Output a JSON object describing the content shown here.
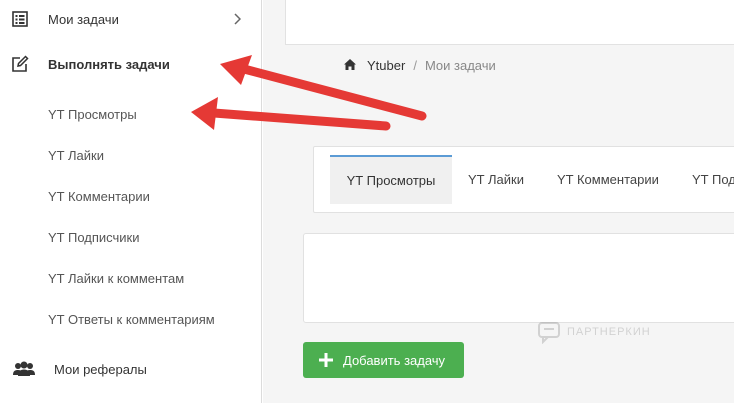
{
  "sidebar": {
    "my_tasks": "Мои задачи",
    "do_tasks": "Выполнять задачи",
    "sub_items": [
      "YT Просмотры",
      "YT Лайки",
      "YT Комментарии",
      "YT Подписчики",
      "YT Лайки к комментам",
      "YT Ответы к комментариям"
    ],
    "referrals": "Мои рефералы"
  },
  "breadcrumb": {
    "link": "Ytuber",
    "separator": "/",
    "current": "Мои задачи"
  },
  "tabs": [
    "YT Просмотры",
    "YT Лайки",
    "YT Комментарии",
    "YT Под"
  ],
  "active_tab": "YT Просмотры",
  "add_button": "Добавить задачу",
  "watermark": "ПАРТНЕРКИН",
  "colors": {
    "accent_green": "#4caf50",
    "tab_active_border": "#5b9bd5",
    "arrow_red": "#e53935"
  }
}
